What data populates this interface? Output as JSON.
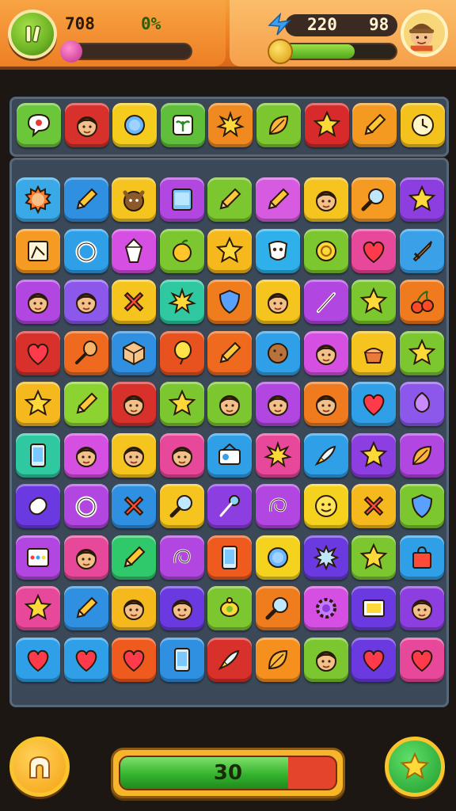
{
  "hud": {
    "left_value": "708",
    "left_percent": "0%",
    "right_value": "220",
    "right_value_2": "98",
    "level_progress": 0.05,
    "energy_progress": 0.65,
    "menu_icon": "pause-icon",
    "avatar_icon": "player-avatar"
  },
  "colors": {
    "accent_orange": "#ef7d1e",
    "board_bg": "#3a4858",
    "timer_green": "#35b32e",
    "timer_red": "#e4432c"
  },
  "tray": [
    {
      "color": "#6cc63a",
      "icon": "speech-bubble-icon"
    },
    {
      "color": "#d8302a",
      "icon": "face-icon"
    },
    {
      "color": "#f5cc1e",
      "icon": "circle-icon"
    },
    {
      "color": "#5fbf3a",
      "icon": "plant-icon"
    },
    {
      "color": "#f08a20",
      "icon": "star-burst-icon"
    },
    {
      "color": "#7cc72f",
      "icon": "leaf-icon"
    },
    {
      "color": "#d82a2a",
      "icon": "star-icon"
    },
    {
      "color": "#f49a20",
      "icon": "pencil-icon"
    },
    {
      "color": "#f3c21c",
      "icon": "clock-icon"
    }
  ],
  "board": [
    [
      {
        "color": "#3aa9e8",
        "icon": "sun-face-icon"
      },
      {
        "color": "#2f8fe0",
        "icon": "pencil-icon"
      },
      {
        "color": "#f5c41e",
        "icon": "animal-face-icon"
      },
      {
        "color": "#b246e0",
        "icon": "tablet-icon"
      },
      {
        "color": "#7cc72f",
        "icon": "pencil-icon"
      },
      {
        "color": "#d75be0",
        "icon": "pencil-icon"
      },
      {
        "color": "#f5c41e",
        "icon": "face-icon"
      },
      {
        "color": "#f59a22",
        "icon": "magnifier-icon"
      },
      {
        "color": "#8c3ee0",
        "icon": "star-icon"
      }
    ],
    [
      {
        "color": "#f59a22",
        "icon": "frame-icon"
      },
      {
        "color": "#2f9fe8",
        "icon": "ring-icon"
      },
      {
        "color": "#d54fe2",
        "icon": "crystal-icon"
      },
      {
        "color": "#7cc72f",
        "icon": "fruit-icon"
      },
      {
        "color": "#f5b91e",
        "icon": "star-icon"
      },
      {
        "color": "#2fb0ea",
        "icon": "mask-icon"
      },
      {
        "color": "#7cc72f",
        "icon": "coin-icon"
      },
      {
        "color": "#e8489a",
        "icon": "heart-icon"
      },
      {
        "color": "#3aa0e8",
        "icon": "sword-icon"
      }
    ],
    [
      {
        "color": "#b246e0",
        "icon": "face-icon"
      },
      {
        "color": "#8c58ec",
        "icon": "face-icon"
      },
      {
        "color": "#f5c41e",
        "icon": "cross-icon"
      },
      {
        "color": "#2fc8a0",
        "icon": "star-burst-icon"
      },
      {
        "color": "#ef7d1e",
        "icon": "shield-icon"
      },
      {
        "color": "#f5c41e",
        "icon": "face-icon"
      },
      {
        "color": "#b246e0",
        "icon": "wand-icon"
      },
      {
        "color": "#7cc72f",
        "icon": "star-icon"
      },
      {
        "color": "#f07a1e",
        "icon": "cherry-icon"
      }
    ],
    [
      {
        "color": "#d8302a",
        "icon": "heart-icon"
      },
      {
        "color": "#ef6a1e",
        "icon": "racket-icon"
      },
      {
        "color": "#2f8fe0",
        "icon": "cube-icon"
      },
      {
        "color": "#e8521e",
        "icon": "balloon-icon"
      },
      {
        "color": "#ef6a1e",
        "icon": "pencil-icon"
      },
      {
        "color": "#2fa0e8",
        "icon": "cookie-icon"
      },
      {
        "color": "#d54fe2",
        "icon": "face-icon"
      },
      {
        "color": "#f5c41e",
        "icon": "cake-icon"
      },
      {
        "color": "#7cc72f",
        "icon": "star-icon"
      }
    ],
    [
      {
        "color": "#f5b91e",
        "icon": "star-icon"
      },
      {
        "color": "#8cd230",
        "icon": "pencil-icon"
      },
      {
        "color": "#d8302a",
        "icon": "face-icon"
      },
      {
        "color": "#7cc72f",
        "icon": "star-icon"
      },
      {
        "color": "#7cc72f",
        "icon": "face-icon"
      },
      {
        "color": "#b246e0",
        "icon": "face-icon"
      },
      {
        "color": "#f07a1e",
        "icon": "face-icon"
      },
      {
        "color": "#2fa0e8",
        "icon": "heart-icon"
      },
      {
        "color": "#8c58ec",
        "icon": "gem-icon"
      }
    ],
    [
      {
        "color": "#2fc8a0",
        "icon": "phone-icon"
      },
      {
        "color": "#d54fe2",
        "icon": "face-icon"
      },
      {
        "color": "#f5c41e",
        "icon": "face-icon"
      },
      {
        "color": "#e8489a",
        "icon": "face-icon"
      },
      {
        "color": "#2fa0e8",
        "icon": "radio-icon"
      },
      {
        "color": "#e8489a",
        "icon": "star-burst-icon"
      },
      {
        "color": "#2fa0e8",
        "icon": "rocket-icon"
      },
      {
        "color": "#8c3ee0",
        "icon": "star-icon"
      },
      {
        "color": "#b246e0",
        "icon": "leaf-icon"
      }
    ],
    [
      {
        "color": "#6a3ae0",
        "icon": "capsule-icon"
      },
      {
        "color": "#b246e0",
        "icon": "ring-icon"
      },
      {
        "color": "#2f8fe0",
        "icon": "cross-icon"
      },
      {
        "color": "#f5c41e",
        "icon": "magnifier-icon"
      },
      {
        "color": "#8c3ee0",
        "icon": "pin-icon"
      },
      {
        "color": "#b246e0",
        "icon": "swirl-icon"
      },
      {
        "color": "#f5d21e",
        "icon": "smile-icon"
      },
      {
        "color": "#f5b91e",
        "icon": "cross-icon"
      },
      {
        "color": "#7cc72f",
        "icon": "shield-icon"
      }
    ],
    [
      {
        "color": "#b246e0",
        "icon": "palette-icon"
      },
      {
        "color": "#e8489a",
        "icon": "face-icon"
      },
      {
        "color": "#2fc86a",
        "icon": "pencil-icon"
      },
      {
        "color": "#b246e0",
        "icon": "swirl-icon"
      },
      {
        "color": "#ef5a1e",
        "icon": "phone-icon"
      },
      {
        "color": "#f5d21e",
        "icon": "circle-icon"
      },
      {
        "color": "#6a3ae0",
        "icon": "splash-icon"
      },
      {
        "color": "#7cc72f",
        "icon": "star-icon"
      },
      {
        "color": "#2fa0e8",
        "icon": "bag-icon"
      }
    ],
    [
      {
        "color": "#e8489a",
        "icon": "star-icon"
      },
      {
        "color": "#2f8fe0",
        "icon": "pencil-icon"
      },
      {
        "color": "#f5b91e",
        "icon": "face-icon"
      },
      {
        "color": "#6a3ae0",
        "icon": "face-icon"
      },
      {
        "color": "#7cc72f",
        "icon": "turtle-icon"
      },
      {
        "color": "#ef7d1e",
        "icon": "magnifier-icon"
      },
      {
        "color": "#d54fe2",
        "icon": "gear-icon"
      },
      {
        "color": "#6a3ae0",
        "icon": "tv-icon"
      },
      {
        "color": "#8c3ee0",
        "icon": "face-icon"
      }
    ],
    [
      {
        "color": "#2fa0e8",
        "icon": "heart-icon"
      },
      {
        "color": "#2fa0e8",
        "icon": "heart-icon"
      },
      {
        "color": "#ef5a1e",
        "icon": "heart-icon"
      },
      {
        "color": "#2f8fe0",
        "icon": "phone-icon"
      },
      {
        "color": "#d8302a",
        "icon": "rocket-icon"
      },
      {
        "color": "#f5901e",
        "icon": "leaf-icon"
      },
      {
        "color": "#7cc72f",
        "icon": "face-icon"
      },
      {
        "color": "#6a3ae0",
        "icon": "heart-icon"
      },
      {
        "color": "#e8489a",
        "icon": "heart-icon"
      }
    ]
  ],
  "bottom": {
    "home_icon": "home-icon",
    "star_icon": "star-icon",
    "timer_value": "30",
    "timer_progress": 0.78
  }
}
